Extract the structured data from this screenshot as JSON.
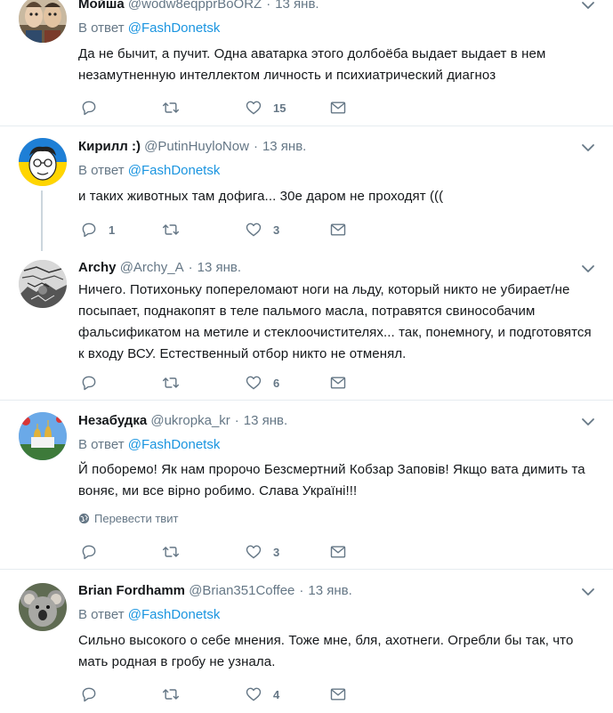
{
  "tweets": [
    {
      "name": "Мойша",
      "handle": "@wodw8eqpprBoORZ",
      "time": "13 янв.",
      "reply_prefix": "В ответ",
      "reply_to": "@FashDonetsk",
      "text": "Да не бычит, а пучит. Одна аватарка этого долбоёба выдает выдает в нем незамутненную интеллектом личность и психиатрический диагноз",
      "replies": "",
      "retweets": "",
      "likes": "15",
      "avatar": "puppets-avatar"
    },
    {
      "name": "Кирилл :)",
      "handle": "@PutinHuyloNow",
      "time": "13 янв.",
      "reply_prefix": "В ответ",
      "reply_to": "@FashDonetsk",
      "text": "и таких животных там дофига... 30е даром не проходят (((",
      "replies": "1",
      "retweets": "",
      "likes": "3",
      "avatar": "cartoon-face-avatar"
    },
    {
      "name": "Archy",
      "handle": "@Archy_A",
      "time": "13 янв.",
      "text": "Ничего. Потихоньку попереломают ноги на льду, который никто не убирает/не посыпает, поднакопят в теле пальмого масла, потравятся свинособачим фальсификатом на метиле и стеклоочистителях... так, понемногу, и подготовятся к входу ВСУ. Естественный отбор никто не отменял.",
      "replies": "",
      "retweets": "",
      "likes": "6",
      "avatar": "sketch-avatar"
    },
    {
      "name": "Незабудка",
      "handle": "@ukropka_kr",
      "time": "13 янв.",
      "reply_prefix": "В ответ",
      "reply_to": "@FashDonetsk",
      "text": "Й поборемо! Як нам пророчо Безсмертний Кобзар Заповів! Якщо вата димить та воняє, ми все вірно робимо. Слава Україні!!!",
      "translate": "Перевести твит",
      "replies": "",
      "retweets": "",
      "likes": "3",
      "avatar": "church-domes-avatar"
    },
    {
      "name": "Brian Fordhamm",
      "handle": "@Brian351Coffee",
      "time": "13 янв.",
      "reply_prefix": "В ответ",
      "reply_to": "@FashDonetsk",
      "text": "Сильно высокого о себе мнения. Тоже мне, бля, ахотнеги. Огребли бы так, что мать родная в гробу не узнала.",
      "replies": "",
      "retweets": "",
      "likes": "4",
      "avatar": "koala-avatar"
    }
  ],
  "colors": {
    "link": "#1b95e0",
    "muted": "#657786",
    "divider": "#e6ecf0",
    "thread_line": "#ccd6dd"
  },
  "icons": [
    "reply-icon",
    "retweet-icon",
    "like-icon",
    "direct-message-icon",
    "caret-down-icon",
    "globe-icon"
  ]
}
